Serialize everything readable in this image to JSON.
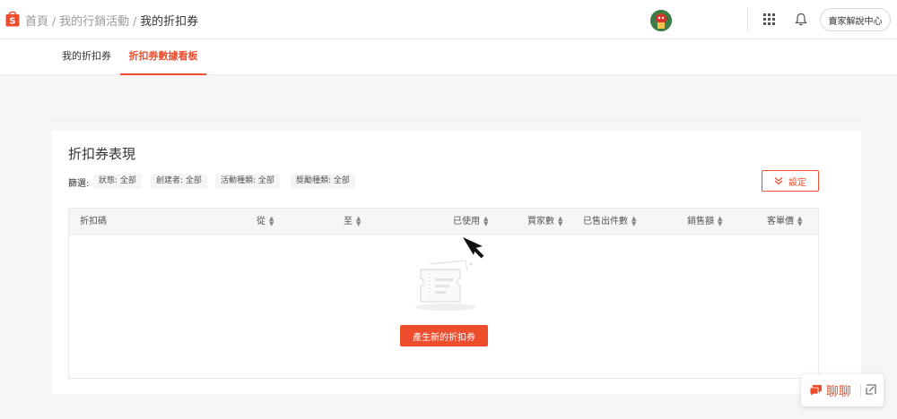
{
  "header": {
    "breadcrumb": [
      "首頁",
      "我的行銷活動",
      "我的折扣券"
    ],
    "separator": "/",
    "help_label": "賣家解說中心",
    "brand_color": "#ee4d2d"
  },
  "tabs": [
    {
      "label": "我的折扣券",
      "active": false
    },
    {
      "label": "折扣券數據看板",
      "active": true
    }
  ],
  "panel": {
    "title": "折扣券表現",
    "filter_label": "篩選:",
    "filters": [
      "狀態: 全部",
      "創建者: 全部",
      "活動種類: 全部",
      "獎勵種類: 全部"
    ],
    "settings_label": "設定",
    "columns": [
      "折扣碼",
      "從",
      "至",
      "已使用",
      "買家數",
      "已售出件數",
      "銷售額",
      "客單價"
    ],
    "create_label": "產生新的折扣券"
  },
  "chat": {
    "label": "聊聊"
  },
  "icons": {
    "logo": "shopee-bag-icon",
    "apps": "apps-grid-icon",
    "notifications": "bell-icon",
    "settings": "double-chevron-down-icon",
    "empty": "empty-voucher-icon",
    "chat": "chat-bubble-icon",
    "expand": "expand-icon",
    "cursor": "mouse-cursor-icon"
  }
}
